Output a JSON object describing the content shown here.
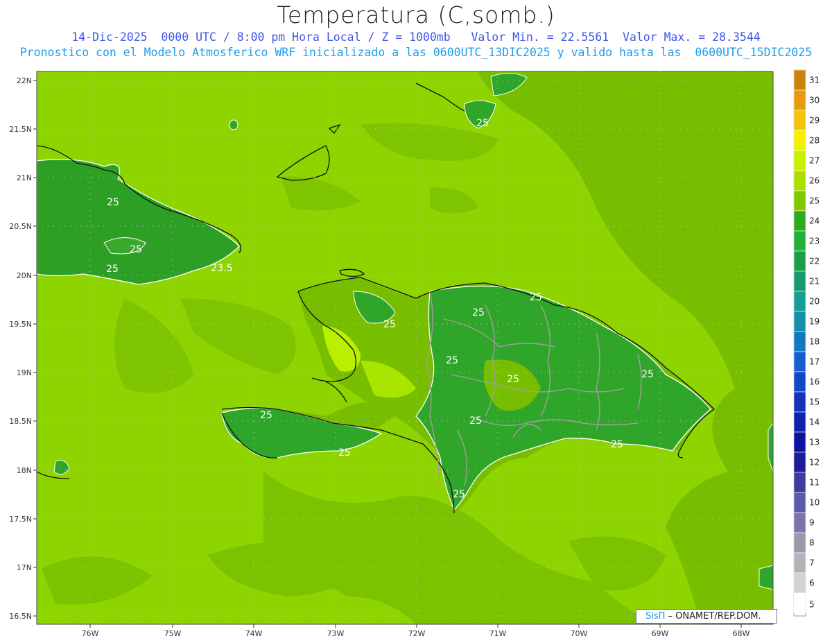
{
  "header": {
    "title": "Temperatura (C,somb.)",
    "line1": "14-Dic-2025  0000 UTC / 8:00 pm Hora Local / Z = 1000mb   Valor Min. = 22.5561  Valor Max. = 28.3544",
    "line2": "Pronostico con el Modelo Atmosferico WRF inicializado a las 0600UTC_13DIC2025 y valido hasta las  0600UTC_15DIC2025"
  },
  "axes": {
    "lat_labels": [
      "22N",
      "21.5N",
      "21N",
      "20.5N",
      "20N",
      "19.5N",
      "19N",
      "18.5N",
      "18N",
      "17.5N",
      "17N",
      "16.5N"
    ],
    "lon_labels": [
      "76W",
      "75W",
      "74W",
      "73W",
      "72W",
      "71W",
      "70W",
      "69W",
      "68W"
    ]
  },
  "colorbar": {
    "levels": [
      "31",
      "30",
      "29",
      "28",
      "27",
      "26",
      "25",
      "24",
      "23",
      "22",
      "21",
      "20",
      "19",
      "18",
      "17",
      "16",
      "15",
      "14",
      "13",
      "12",
      "11",
      "10",
      "9",
      "8",
      "7",
      "6",
      "5"
    ],
    "colors": [
      "#c8840a",
      "#e89a0a",
      "#f5c40a",
      "#f5f000",
      "#c8f000",
      "#a8e000",
      "#84c800",
      "#2eaa1e",
      "#22b038",
      "#1c9e46",
      "#1a9a6c",
      "#159e92",
      "#1490a8",
      "#1478c0",
      "#1460cf",
      "#1446c8",
      "#1432bc",
      "#1220aa",
      "#0f12a0",
      "#1c1c96",
      "#3c3ca0",
      "#5a5aa8",
      "#8070b0",
      "#9a9aa8",
      "#b4b4b4",
      "#d2d2d2",
      "#ffffff"
    ]
  },
  "contour_labels": [
    "25",
    "25",
    "25",
    "23.5",
    "25",
    "25",
    "25",
    "25",
    "25",
    "25",
    "25",
    "25",
    "25",
    "25",
    "25",
    "25"
  ],
  "credit": {
    "brand": "SisΠ",
    "text": " – ONAMET/REP.DOM."
  }
}
